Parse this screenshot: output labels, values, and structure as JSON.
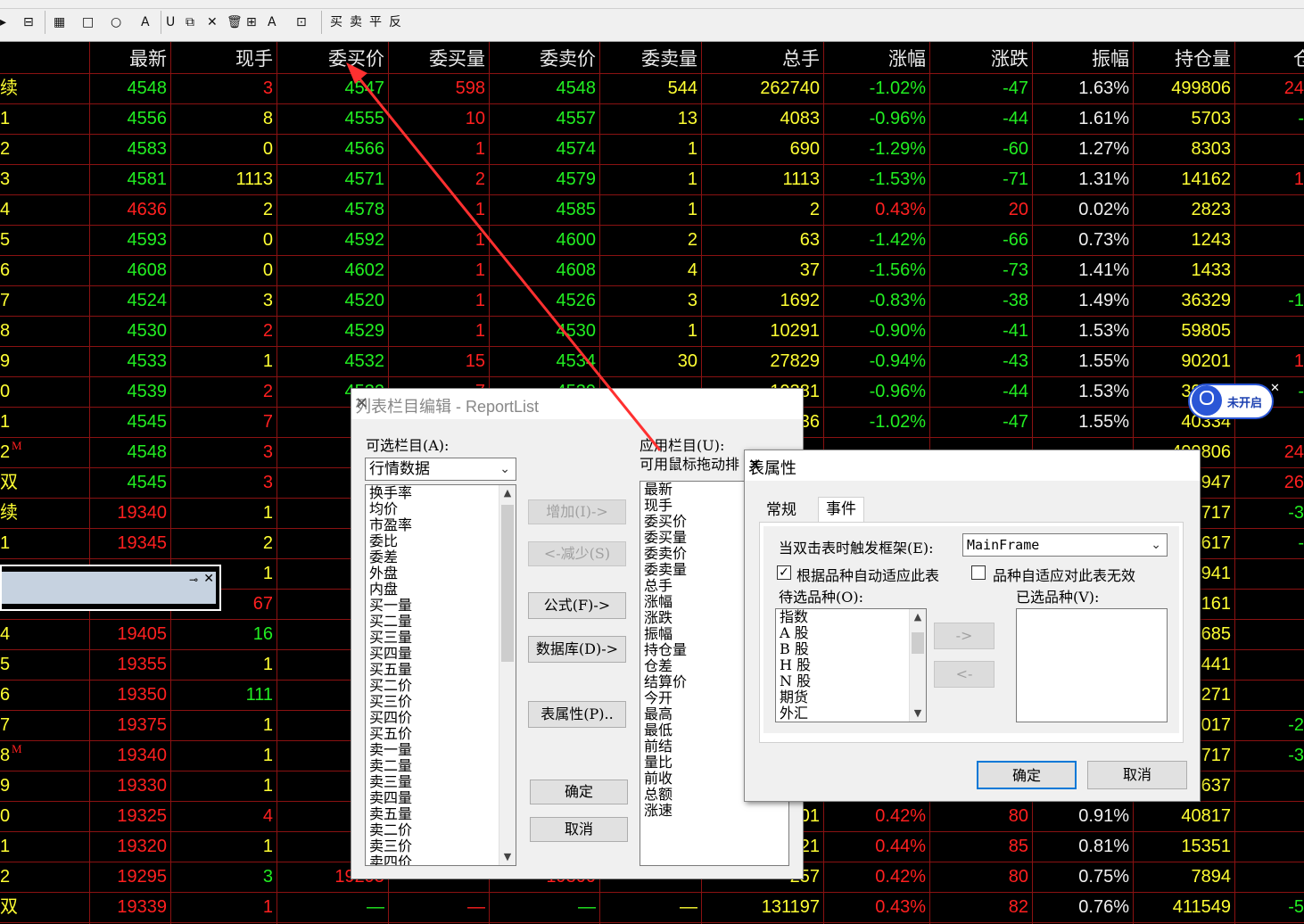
{
  "toolbar": {
    "items": [
      "▸",
      "⊟",
      "▦",
      "□",
      "○",
      "A",
      "U",
      "⧉",
      "✕",
      "🗑",
      "⊞",
      "A",
      "⊡",
      "买",
      "卖",
      "平",
      "反"
    ]
  },
  "grid": {
    "headers": [
      "最新",
      "现手",
      "委买价",
      "委买量",
      "委卖价",
      "委卖量",
      "总手",
      "涨幅",
      "涨跌",
      "振幅",
      "持仓量",
      "仓"
    ],
    "rows": [
      {
        "lbl": "续",
        "v": [
          "4548",
          "3",
          "4547",
          "598",
          "4548",
          "544",
          "262740",
          "-1.02%",
          "-47",
          "1.63%",
          "499806",
          "24"
        ],
        "c": [
          "g",
          "r",
          "g",
          "r",
          "g",
          "y",
          "y",
          "g",
          "g",
          "w",
          "y",
          "r"
        ]
      },
      {
        "lbl": "1",
        "v": [
          "4556",
          "8",
          "4555",
          "10",
          "4557",
          "13",
          "4083",
          "-0.96%",
          "-44",
          "1.61%",
          "5703",
          "-"
        ],
        "c": [
          "g",
          "y",
          "g",
          "r",
          "g",
          "y",
          "y",
          "g",
          "g",
          "w",
          "y",
          "g"
        ]
      },
      {
        "lbl": "2",
        "v": [
          "4583",
          "0",
          "4566",
          "1",
          "4574",
          "1",
          "690",
          "-1.29%",
          "-60",
          "1.27%",
          "8303",
          ""
        ],
        "c": [
          "g",
          "y",
          "g",
          "r",
          "g",
          "y",
          "y",
          "g",
          "g",
          "w",
          "y",
          "g"
        ]
      },
      {
        "lbl": "3",
        "v": [
          "4581",
          "1113",
          "4571",
          "2",
          "4579",
          "1",
          "1113",
          "-1.53%",
          "-71",
          "1.31%",
          "14162",
          "1"
        ],
        "c": [
          "g",
          "y",
          "g",
          "r",
          "g",
          "y",
          "y",
          "g",
          "g",
          "w",
          "y",
          "r"
        ]
      },
      {
        "lbl": "4",
        "v": [
          "4636",
          "2",
          "4578",
          "1",
          "4585",
          "1",
          "2",
          "0.43%",
          "20",
          "0.02%",
          "2823",
          ""
        ],
        "c": [
          "r",
          "y",
          "g",
          "r",
          "g",
          "y",
          "y",
          "r",
          "r",
          "w",
          "y",
          "g"
        ]
      },
      {
        "lbl": "5",
        "v": [
          "4593",
          "0",
          "4592",
          "1",
          "4600",
          "2",
          "63",
          "-1.42%",
          "-66",
          "0.73%",
          "1243",
          ""
        ],
        "c": [
          "g",
          "y",
          "g",
          "r",
          "g",
          "y",
          "y",
          "g",
          "g",
          "w",
          "y",
          "g"
        ]
      },
      {
        "lbl": "6",
        "v": [
          "4608",
          "0",
          "4602",
          "1",
          "4608",
          "4",
          "37",
          "-1.56%",
          "-73",
          "1.41%",
          "1433",
          ""
        ],
        "c": [
          "g",
          "y",
          "g",
          "r",
          "g",
          "y",
          "y",
          "g",
          "g",
          "w",
          "y",
          "g"
        ]
      },
      {
        "lbl": "7",
        "v": [
          "4524",
          "3",
          "4520",
          "1",
          "4526",
          "3",
          "1692",
          "-0.83%",
          "-38",
          "1.49%",
          "36329",
          "-1"
        ],
        "c": [
          "g",
          "y",
          "g",
          "r",
          "g",
          "y",
          "y",
          "g",
          "g",
          "w",
          "y",
          "g"
        ]
      },
      {
        "lbl": "8",
        "v": [
          "4530",
          "2",
          "4529",
          "1",
          "4530",
          "1",
          "10291",
          "-0.90%",
          "-41",
          "1.53%",
          "59805",
          ""
        ],
        "c": [
          "g",
          "r",
          "g",
          "r",
          "g",
          "y",
          "y",
          "g",
          "g",
          "w",
          "y",
          "g"
        ]
      },
      {
        "lbl": "9",
        "v": [
          "4533",
          "1",
          "4532",
          "15",
          "4534",
          "30",
          "27829",
          "-0.94%",
          "-43",
          "1.55%",
          "90201",
          "1"
        ],
        "c": [
          "g",
          "y",
          "g",
          "r",
          "g",
          "y",
          "y",
          "g",
          "g",
          "w",
          "y",
          "r"
        ]
      },
      {
        "lbl": "0",
        "v": [
          "4539",
          "2",
          "4532",
          "7",
          "4539",
          "",
          "19381",
          "-0.96%",
          "-44",
          "1.53%",
          "39315",
          "-"
        ],
        "c": [
          "g",
          "r",
          "g",
          "r",
          "g",
          "y",
          "y",
          "g",
          "g",
          "w",
          "y",
          "g"
        ]
      },
      {
        "lbl": "1",
        "v": [
          "4545",
          "7",
          "",
          "",
          "",
          "",
          "36",
          "-1.02%",
          "-47",
          "1.55%",
          "40334",
          ""
        ],
        "c": [
          "g",
          "r",
          "g",
          "r",
          "g",
          "y",
          "y",
          "g",
          "g",
          "w",
          "y",
          "g"
        ]
      },
      {
        "lbl": "2",
        "m": "M",
        "v": [
          "4548",
          "3",
          "",
          "",
          "",
          "",
          "",
          "",
          "",
          "",
          "499806",
          "24"
        ],
        "c": [
          "g",
          "r",
          "g",
          "r",
          "g",
          "y",
          "y",
          "g",
          "g",
          "w",
          "y",
          "r"
        ]
      },
      {
        "lbl": "双",
        "v": [
          "4545",
          "3",
          "",
          "",
          "",
          "",
          "",
          "",
          "",
          "",
          "947",
          "26"
        ],
        "c": [
          "g",
          "r",
          "g",
          "r",
          "g",
          "y",
          "y",
          "g",
          "g",
          "w",
          "y",
          "r"
        ]
      },
      {
        "lbl": "续",
        "v": [
          "19340",
          "1",
          "19",
          "",
          "",
          "",
          "",
          "",
          "",
          "",
          "717",
          "-3"
        ],
        "c": [
          "r",
          "y",
          "r",
          "r",
          "g",
          "y",
          "y",
          "r",
          "r",
          "w",
          "y",
          "g"
        ]
      },
      {
        "lbl": "1",
        "v": [
          "19345",
          "2",
          "19",
          "",
          "",
          "",
          "",
          "",
          "",
          "",
          "617",
          "-"
        ],
        "c": [
          "r",
          "y",
          "r",
          "r",
          "g",
          "y",
          "y",
          "r",
          "r",
          "w",
          "y",
          "g"
        ]
      },
      {
        "lbl": "",
        "v": [
          "",
          "1",
          "18",
          "",
          "",
          "",
          "",
          "",
          "",
          "",
          "941",
          ""
        ],
        "c": [
          "r",
          "y",
          "r",
          "r",
          "g",
          "y",
          "y",
          "r",
          "r",
          "w",
          "y",
          "g"
        ]
      },
      {
        "lbl": "",
        "v": [
          "",
          "67",
          "18",
          "",
          "",
          "",
          "",
          "",
          "",
          "",
          "161",
          ""
        ],
        "c": [
          "r",
          "r",
          "r",
          "r",
          "g",
          "y",
          "y",
          "r",
          "r",
          "w",
          "y",
          "g"
        ]
      },
      {
        "lbl": "4",
        "v": [
          "19405",
          "16",
          "19",
          "",
          "",
          "",
          "",
          "",
          "",
          "",
          "685",
          ""
        ],
        "c": [
          "r",
          "g",
          "r",
          "r",
          "g",
          "y",
          "y",
          "r",
          "r",
          "w",
          "y",
          "g"
        ]
      },
      {
        "lbl": "5",
        "v": [
          "19355",
          "1",
          "19",
          "",
          "",
          "",
          "",
          "",
          "",
          "",
          "441",
          ""
        ],
        "c": [
          "r",
          "y",
          "r",
          "r",
          "g",
          "y",
          "y",
          "r",
          "r",
          "w",
          "y",
          "g"
        ]
      },
      {
        "lbl": "6",
        "v": [
          "19350",
          "111",
          "19",
          "",
          "",
          "",
          "",
          "",
          "",
          "",
          "271",
          ""
        ],
        "c": [
          "r",
          "g",
          "r",
          "r",
          "g",
          "y",
          "y",
          "r",
          "r",
          "w",
          "y",
          "g"
        ]
      },
      {
        "lbl": "7",
        "v": [
          "19375",
          "1",
          "19",
          "",
          "",
          "",
          "",
          "",
          "",
          "",
          "017",
          "-2"
        ],
        "c": [
          "r",
          "y",
          "r",
          "r",
          "g",
          "y",
          "y",
          "r",
          "r",
          "w",
          "y",
          "g"
        ]
      },
      {
        "lbl": "8",
        "m": "M",
        "v": [
          "19340",
          "1",
          "19",
          "",
          "",
          "",
          "",
          "",
          "",
          "",
          "717",
          "-3"
        ],
        "c": [
          "r",
          "y",
          "r",
          "r",
          "g",
          "y",
          "y",
          "r",
          "r",
          "w",
          "y",
          "g"
        ]
      },
      {
        "lbl": "9",
        "v": [
          "19330",
          "1",
          "19",
          "",
          "",
          "",
          "",
          "",
          "",
          "",
          "637",
          ""
        ],
        "c": [
          "r",
          "y",
          "r",
          "r",
          "g",
          "y",
          "y",
          "r",
          "r",
          "w",
          "y",
          "g"
        ]
      },
      {
        "lbl": "0",
        "v": [
          "19325",
          "4",
          "19",
          "",
          "",
          "",
          "01",
          "0.42%",
          "80",
          "0.91%",
          "40817",
          ""
        ],
        "c": [
          "r",
          "r",
          "r",
          "r",
          "g",
          "y",
          "y",
          "r",
          "r",
          "w",
          "y",
          "g"
        ]
      },
      {
        "lbl": "1",
        "v": [
          "19320",
          "1",
          "19",
          "",
          "",
          "",
          "21",
          "0.44%",
          "85",
          "0.81%",
          "15351",
          ""
        ],
        "c": [
          "r",
          "y",
          "r",
          "r",
          "g",
          "y",
          "y",
          "r",
          "r",
          "w",
          "y",
          "g"
        ]
      },
      {
        "lbl": "2",
        "v": [
          "19295",
          "3",
          "19295",
          "",
          "19300",
          "",
          "257",
          "0.42%",
          "80",
          "0.75%",
          "7894",
          ""
        ],
        "c": [
          "r",
          "g",
          "r",
          "r",
          "r",
          "g",
          "y",
          "r",
          "r",
          "w",
          "y",
          "g"
        ]
      },
      {
        "lbl": "双",
        "v": [
          "19339",
          "1",
          "—",
          "—",
          "—",
          "—",
          "131197",
          "0.43%",
          "82",
          "0.76%",
          "411549",
          "-5"
        ],
        "c": [
          "r",
          "r",
          "g",
          "r",
          "g",
          "y",
          "y",
          "r",
          "r",
          "w",
          "y",
          "g"
        ]
      }
    ]
  },
  "badge": {
    "label": "未开启"
  },
  "dialog1": {
    "title": "列表栏目编辑 - ReportList",
    "avail_label": "可选栏目(A):",
    "category": "行情数据",
    "avail_items": [
      "换手率",
      "均价",
      "市盈率",
      "委比",
      "委差",
      "外盘",
      "内盘",
      "买一量",
      "买二量",
      "买三量",
      "买四量",
      "买五量",
      "买二价",
      "买三价",
      "买四价",
      "买五价",
      "卖一量",
      "卖二量",
      "卖三量",
      "卖四量",
      "卖五量",
      "卖二价",
      "卖三价",
      "卖四价"
    ],
    "applied_label": "应用栏目(U):",
    "applied_hint": "可用鼠标拖动排",
    "applied_items": [
      "最新",
      "现手",
      "委买价",
      "委买量",
      "委卖价",
      "委卖量",
      "总手",
      "涨幅",
      "涨跌",
      "振幅",
      "持仓量",
      "仓差",
      "结算价",
      "今开",
      "最高",
      "最低",
      "前结",
      "量比",
      "前收",
      "总额",
      "涨速"
    ],
    "btn_add": "增加(I)->",
    "btn_remove": "<-减少(S)",
    "btn_formula": "公式(F)->",
    "btn_db": "数据库(D)->",
    "btn_props": "表属性(P)..",
    "btn_ok": "确定",
    "btn_cancel": "取消"
  },
  "dialog2": {
    "title": "表属性",
    "tab_general": "常规",
    "tab_event": "事件",
    "dbl_label": "当双击表时触发框架(E):",
    "frame_value": "MainFrame",
    "chk_auto": "根据品种自动适应此表",
    "chk_invalid": "品种自适应对此表无效",
    "pending_label": "待选品种(O):",
    "selected_label": "已选品种(V):",
    "pending_items": [
      "指数",
      "A 股",
      "B 股",
      "H 股",
      "N 股",
      "期货",
      "外汇"
    ],
    "btn_right": "->",
    "btn_left": "<-",
    "btn_ok": "确定",
    "btn_cancel": "取消"
  }
}
